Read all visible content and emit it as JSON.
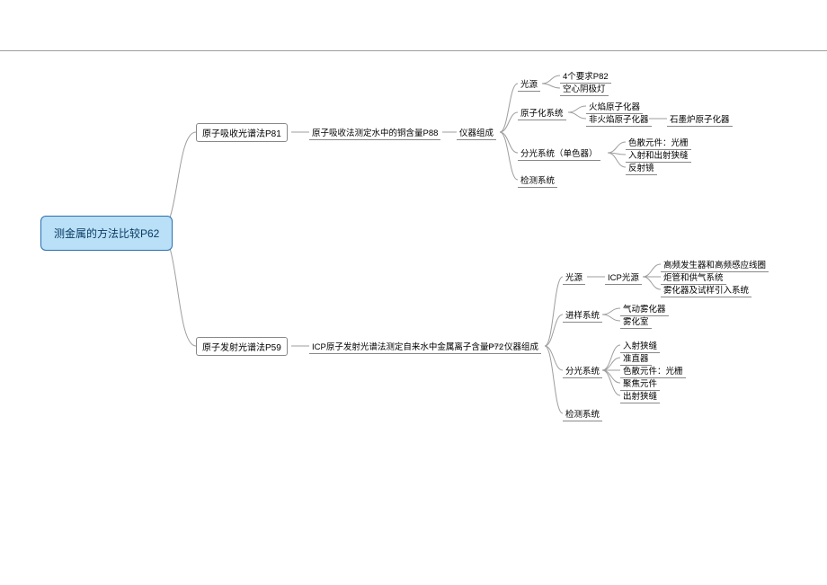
{
  "root": "测金属的方法比较P62",
  "b1": {
    "title": "原子吸收光谱法P81",
    "sub": "原子吸收法测定水中的铜含量P88",
    "inst": "仪器组成",
    "c1": {
      "label": "光源",
      "l1": "4个要求P82",
      "l2": "空心阴极灯"
    },
    "c2": {
      "label": "原子化系统",
      "l1": "火焰原子化器",
      "l2": "非火焰原子化器",
      "l2b": "石墨炉原子化器"
    },
    "c3": {
      "label": "分光系统（单色器）",
      "l1": "色散元件：光栅",
      "l2": "入射和出射狭缝",
      "l3": "反射镜"
    },
    "c4": {
      "label": "检测系统"
    }
  },
  "b2": {
    "title": "原子发射光谱法P59",
    "sub": "ICP原子发射光谱法测定自来水中金属离子含量P72",
    "inst": "仪器组成",
    "c1": {
      "label": "光源",
      "mid": "ICP光源",
      "l1": "高频发生器和高频感应线圈",
      "l2": "炬管和供气系统",
      "l3": "雾化器及试样引入系统"
    },
    "c2": {
      "label": "进样系统",
      "l1": "气动雾化器",
      "l2": "雾化室"
    },
    "c3": {
      "label": "分光系统",
      "l1": "入射狭缝",
      "l2": "准直器",
      "l3": "色散元件：光栅",
      "l4": "聚焦元件",
      "l5": "出射狭缝"
    },
    "c4": {
      "label": "检测系统"
    }
  }
}
